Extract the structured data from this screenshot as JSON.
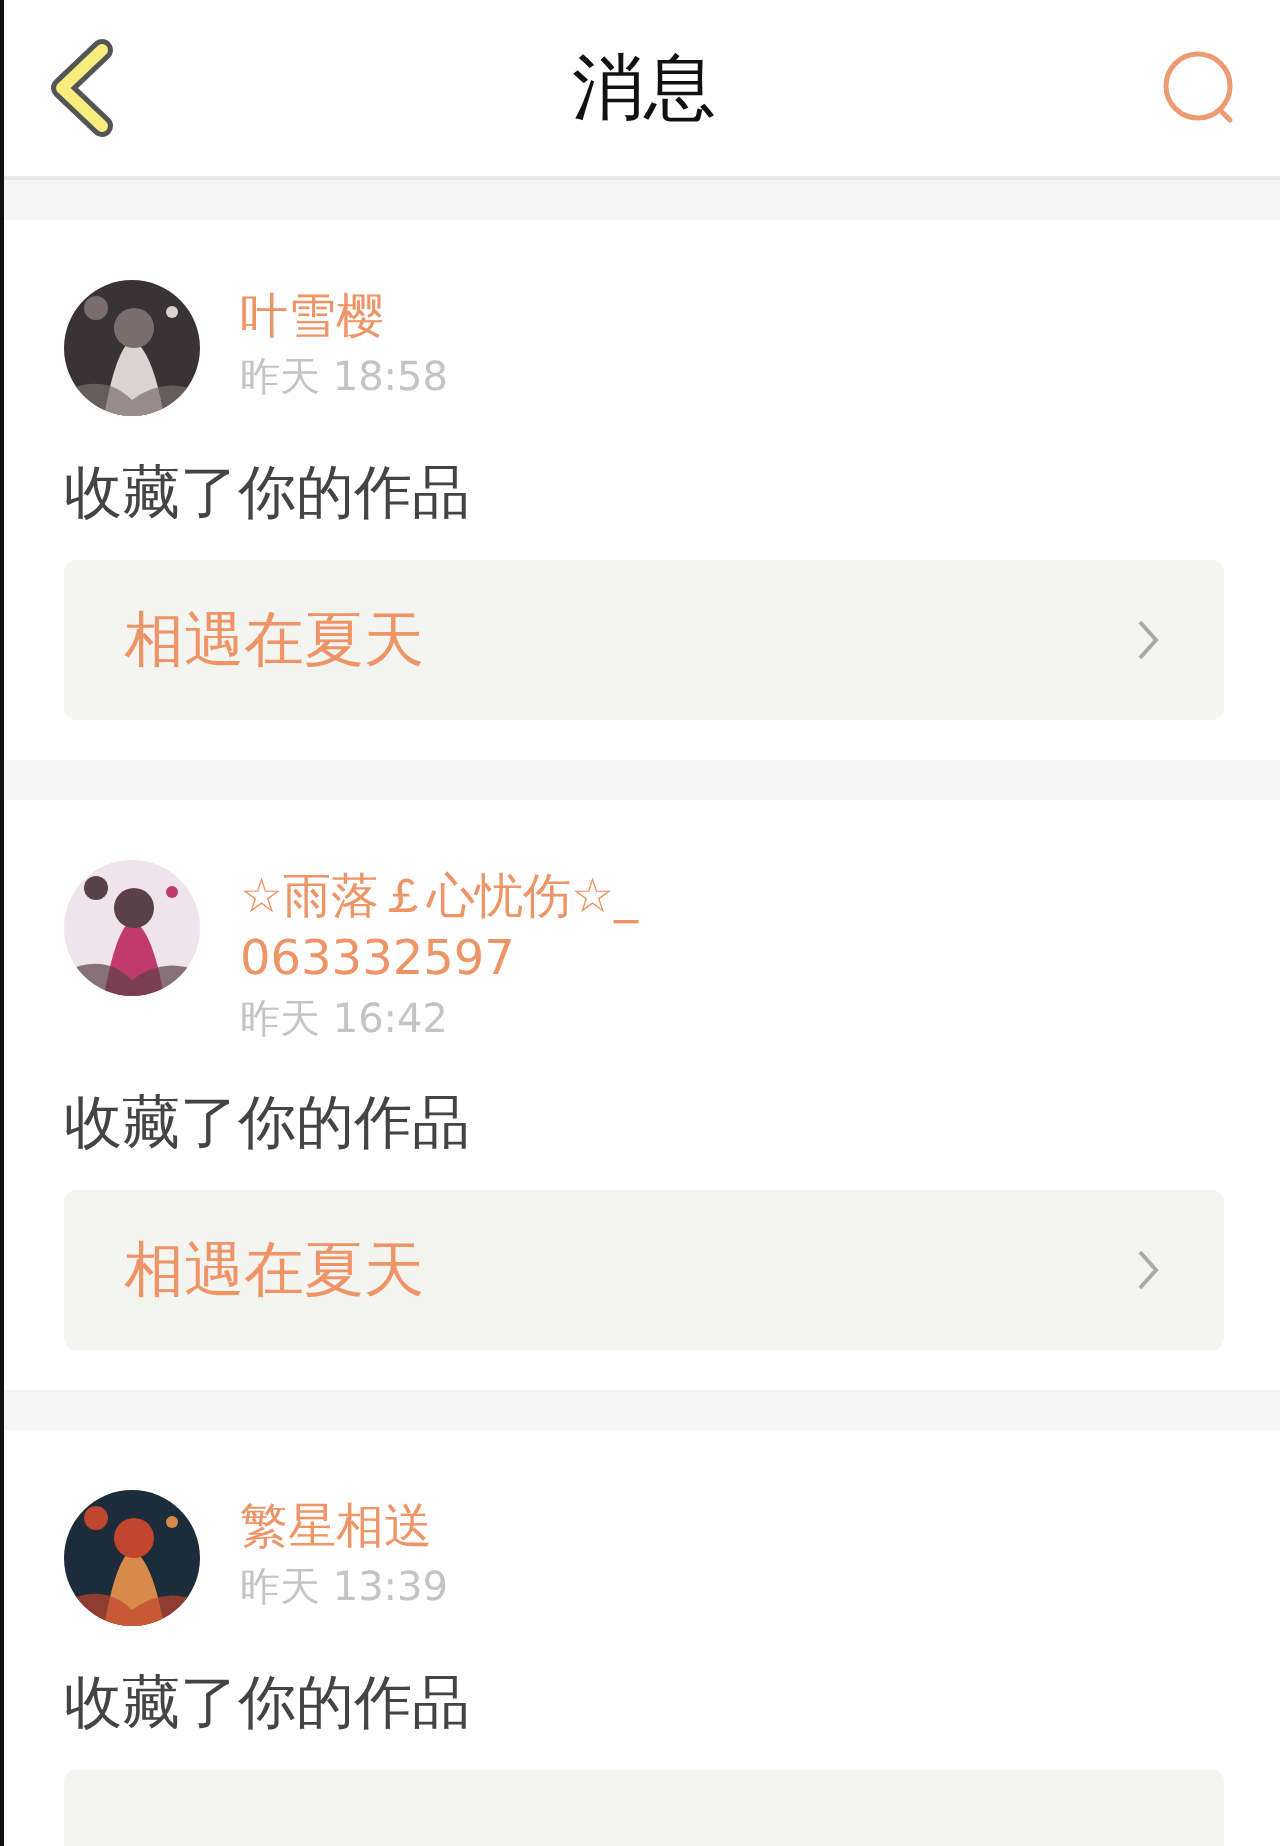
{
  "header": {
    "title": "消息"
  },
  "messages": [
    {
      "name": "叶雪樱",
      "time": "昨天 18:58",
      "action": "收藏了你的作品",
      "work": {
        "kind": "link",
        "title": "相遇在夏天"
      }
    },
    {
      "name": "☆雨落￡心忧伤☆_063332597",
      "time": "昨天 16:42",
      "action": "收藏了你的作品",
      "work": {
        "kind": "link",
        "title": "相遇在夏天"
      }
    },
    {
      "name": "繁星相送",
      "time": "昨天 13:39",
      "action": "收藏了你的作品",
      "work": {
        "kind": "link"
      }
    }
  ]
}
